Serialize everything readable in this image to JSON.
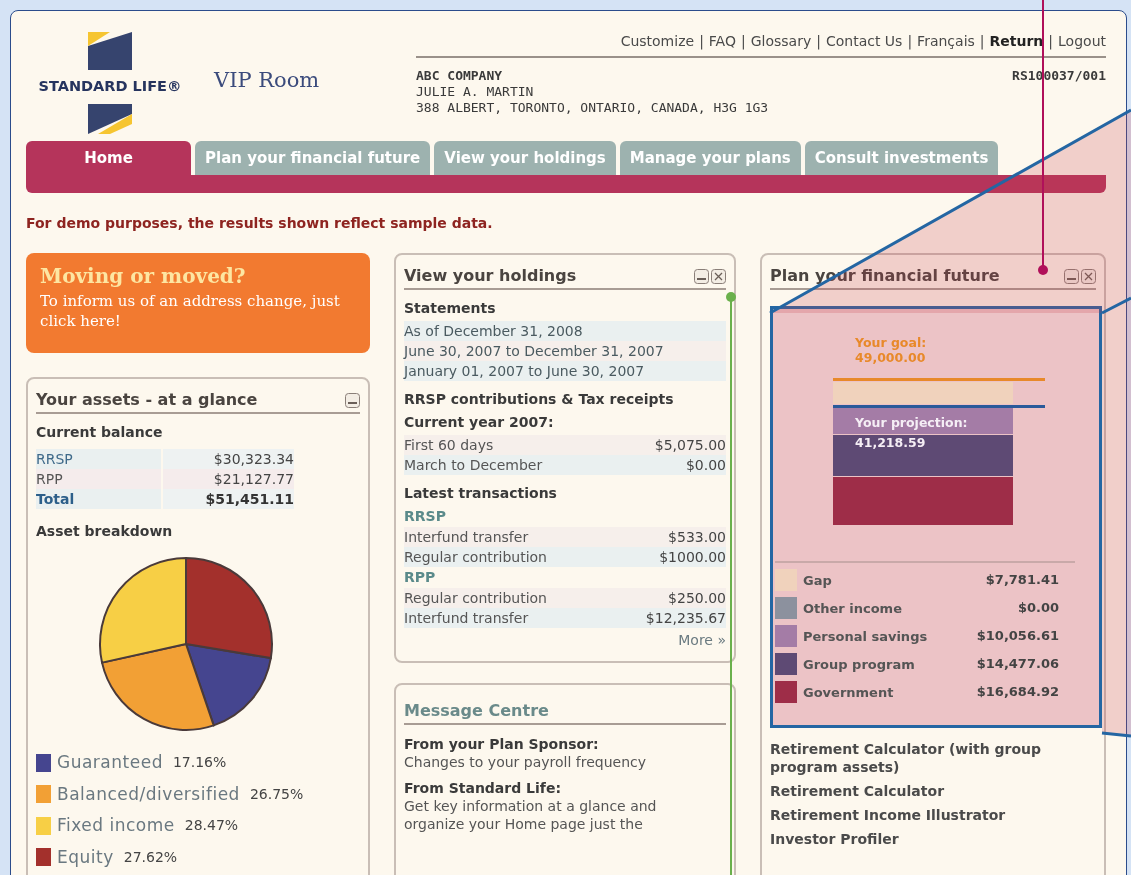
{
  "header": {
    "brand": "STANDARD LIFE®",
    "product": "VIP Room",
    "links": [
      {
        "label": "Customize",
        "bold": false
      },
      {
        "separator": "|",
        "label": "FAQ",
        "bold": false
      },
      {
        "separator": "|",
        "label": "Glossary",
        "bold": false
      },
      {
        "separator": "|",
        "label": "Contact Us",
        "bold": false
      },
      {
        "separator": "|",
        "label": "Français",
        "bold": false
      },
      {
        "separator": "|",
        "label": "Return",
        "bold": true
      },
      {
        "separator": "|",
        "label": "Logout",
        "bold": false
      }
    ],
    "company": "ABC COMPANY",
    "member": "JULIE A. MARTIN",
    "address": "388 ALBERT, TORONTO, ONTARIO, CANADA, H3G 1G3",
    "account": "RS100037/001"
  },
  "tabs": [
    {
      "label": "Home",
      "selected": true
    },
    {
      "label": "Plan your financial future",
      "selected": false
    },
    {
      "label": "View your holdings",
      "selected": false
    },
    {
      "label": "Manage your plans",
      "selected": false
    },
    {
      "label": "Consult investments",
      "selected": false
    }
  ],
  "notice": "For demo purposes, the results shown reflect sample data.",
  "moving_banner": {
    "title": "Moving or moved?",
    "text": "To inform us of an address change, just click here!"
  },
  "assets_panel": {
    "title": "Your assets - at a glance",
    "balance_heading": "Current balance",
    "balances": [
      {
        "label": "RRSP",
        "amount": "$30,323.34",
        "kind": "account"
      },
      {
        "label": "RPP",
        "amount": "$21,127.77",
        "kind": "account"
      },
      {
        "label": "Total",
        "amount": "$51,451.11",
        "kind": "total"
      }
    ],
    "breakdown_heading": "Asset breakdown",
    "chart_data": {
      "type": "pie",
      "values": [
        17.16,
        26.75,
        28.47,
        27.62
      ]
    },
    "legend": [
      {
        "label": "Guaranteed",
        "value": "17.16%",
        "color": "#45458f"
      },
      {
        "label": "Balanced/diversified",
        "value": "26.75%",
        "color": "#f2a035"
      },
      {
        "label": "Fixed income",
        "value": "28.47%",
        "color": "#f7cf45"
      },
      {
        "label": "Equity",
        "value": "27.62%",
        "color": "#a3302c"
      }
    ]
  },
  "holdings_panel": {
    "title": "View your holdings",
    "items": [
      {
        "kind": "heading",
        "label": "Statements"
      },
      {
        "kind": "statement",
        "label": "As of December 31, 2008"
      },
      {
        "kind": "statement",
        "label": "June 30, 2007 to December 31, 2007"
      },
      {
        "kind": "statement",
        "label": "January 01, 2007 to June 30, 2007"
      },
      {
        "kind": "heading",
        "label": "RRSP contributions & Tax receipts"
      },
      {
        "kind": "heading",
        "label": "Current year 2007:"
      },
      {
        "kind": "row",
        "label": "First 60 days",
        "amount": "$5,075.00"
      },
      {
        "kind": "row",
        "label": "March to December",
        "amount": "$0.00"
      },
      {
        "kind": "heading",
        "label": "Latest transactions"
      },
      {
        "kind": "subheading",
        "label": "RRSP"
      },
      {
        "kind": "row",
        "label": "Interfund transfer",
        "amount": "$533.00"
      },
      {
        "kind": "row",
        "label": "Regular contribution",
        "amount": "$1000.00"
      },
      {
        "kind": "subheading",
        "label": "RPP"
      },
      {
        "kind": "row",
        "label": "Regular contribution",
        "amount": "$250.00"
      },
      {
        "kind": "row",
        "label": "Interfund transfer",
        "amount": "$12,235.67"
      }
    ],
    "more": "More »"
  },
  "message_centre": {
    "title": "Message Centre",
    "messages": [
      {
        "from": "From your Plan Sponsor:",
        "lines": [
          "Changes to your payroll frequency"
        ]
      },
      {
        "from": "From Standard Life:",
        "lines": [
          "Get key information at a glance and",
          "organize your Home page just the"
        ]
      }
    ]
  },
  "plan_panel": {
    "title": "Plan your financial future",
    "goal": [
      "Your goal:",
      "49,000.00"
    ],
    "projection": [
      "Your projection:",
      "41,218.59"
    ],
    "legend": [
      {
        "label": "Gap",
        "amount": "$7,781.41",
        "color": "#f0d2bc"
      },
      {
        "label": "Other income",
        "amount": "$0.00",
        "color": "#8c919e"
      },
      {
        "label": "Personal savings",
        "amount": "$10,056.61",
        "color": "#a47ca6"
      },
      {
        "label": "Group program",
        "amount": "$14,477.06",
        "color": "#5e4a74"
      },
      {
        "label": "Government",
        "amount": "$16,684.92",
        "color": "#9e2d48"
      }
    ],
    "links": [
      "Retirement Calculator (with group program assets)",
      "Retirement Calculator",
      "Retirement Income Illustrator",
      "Investor Profiler"
    ]
  }
}
